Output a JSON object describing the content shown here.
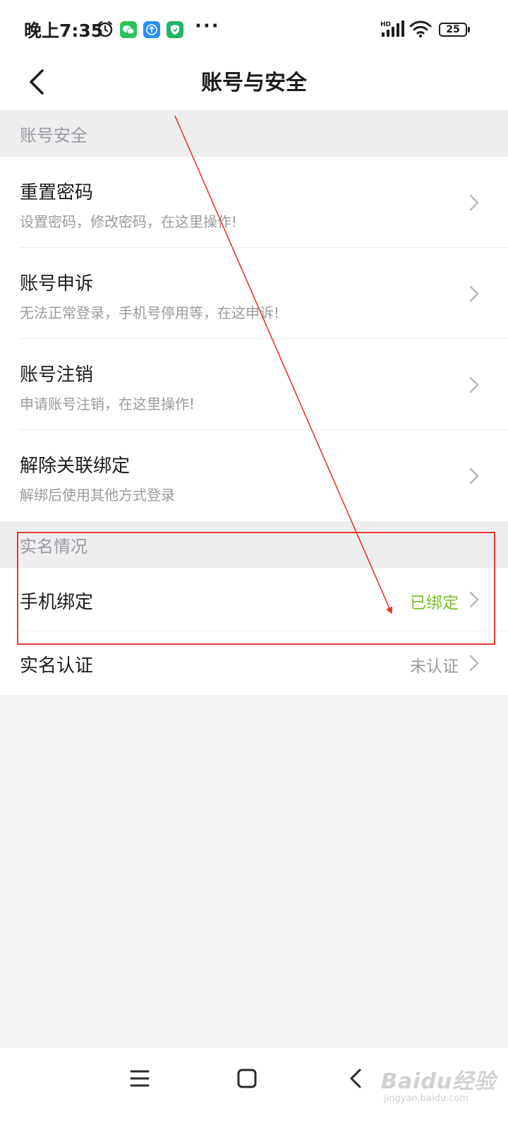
{
  "status_bar": {
    "time": "晚上7:35",
    "network_label": "HD",
    "battery": "25",
    "more": "···"
  },
  "header": {
    "title": "账号与安全"
  },
  "sections": [
    {
      "title": "账号安全",
      "items": [
        {
          "title": "重置密码",
          "subtitle": "设置密码，修改密码，在这里操作!"
        },
        {
          "title": "账号申诉",
          "subtitle": "无法正常登录，手机号停用等，在这申诉!"
        },
        {
          "title": "账号注销",
          "subtitle": "申请账号注销，在这里操作!"
        },
        {
          "title": "解除关联绑定",
          "subtitle": "解绑后使用其他方式登录"
        }
      ]
    },
    {
      "title": "实名情况",
      "items": [
        {
          "title": "手机绑定",
          "value": "已绑定",
          "value_color": "#7ac02b"
        },
        {
          "title": "实名认证",
          "value": "未认证",
          "value_color": "#9a9a9f"
        }
      ]
    }
  ],
  "watermark": {
    "main": "Baidu经验",
    "sub": "jingyan.baidu.com"
  },
  "colors": {
    "annotation": "#e23a30",
    "bound_green": "#7ac02b"
  }
}
